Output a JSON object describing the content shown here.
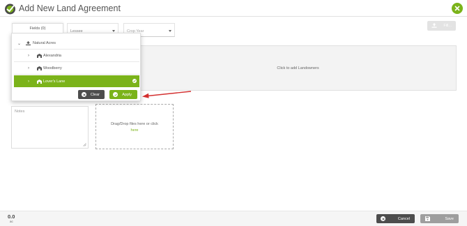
{
  "header": {
    "title": "Add New Land Agreement",
    "accent_color": "#7bb31a"
  },
  "filters": {
    "fields_tab_label": "Fields (0)",
    "lessee_placeholder": "Lessee",
    "crop_year_placeholder": "Crop Year",
    "fill_button_label": "Fill..."
  },
  "landowners": {
    "prompt": "Click to add Landowners"
  },
  "field_tree": {
    "parent": {
      "label": "Natural Acres",
      "icon": "upload-person-icon",
      "expanded": true
    },
    "children": [
      {
        "label": "Alexandria",
        "icon": "barn-icon",
        "selected": false
      },
      {
        "label": "Woodberry",
        "icon": "barn-icon",
        "selected": false
      },
      {
        "label": "Lover's Lane",
        "icon": "barn-icon",
        "selected": true
      }
    ],
    "clear_label": "Clear",
    "apply_label": "Apply"
  },
  "notes": {
    "placeholder": "Notes"
  },
  "dropzone": {
    "text": "Drag/Drop files here or click",
    "link_text": "here"
  },
  "footer": {
    "acres_value": "0.0",
    "acres_unit": "ac",
    "cancel_label": "Cancel",
    "save_label": "Save"
  },
  "colors": {
    "accent": "#7bb31a",
    "dark_button": "#4d4d4d",
    "disabled_button": "#9e9e9e",
    "annotation_arrow": "#d32f2f"
  }
}
